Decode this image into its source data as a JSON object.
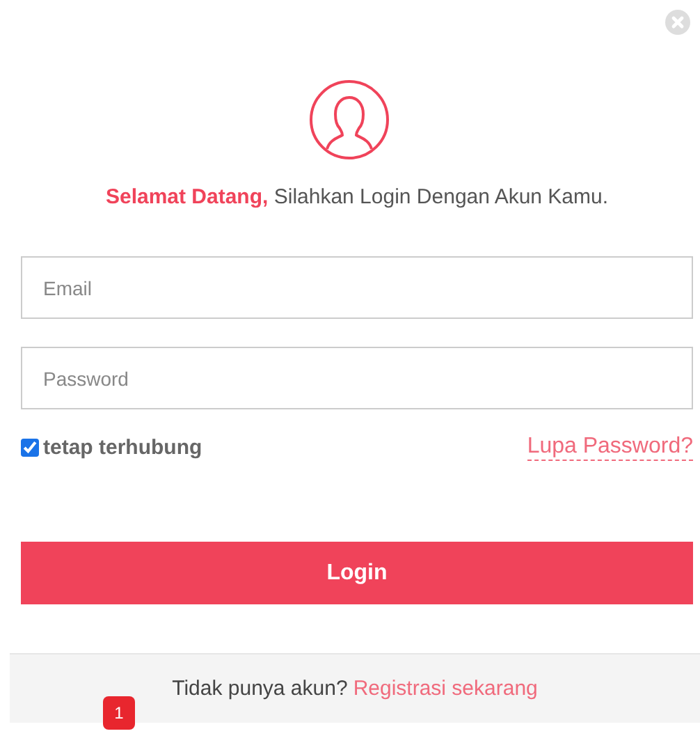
{
  "welcome": {
    "text": "**Selamat Datang,** Silahkan Login Dengan Akun Kamu."
  },
  "fields": [
    {
      "placeholder": "Email"
    },
    {
      "placeholder": "Password"
    }
  ],
  "remember": {
    "label": "tetap terhubung",
    "checked": true
  },
  "forgot_link": "Lupa Password?",
  "login_button": "Login",
  "footer": {
    "text": "Tidak punya akun?",
    "link": "Registrasi sekarang"
  },
  "badge": "1"
}
